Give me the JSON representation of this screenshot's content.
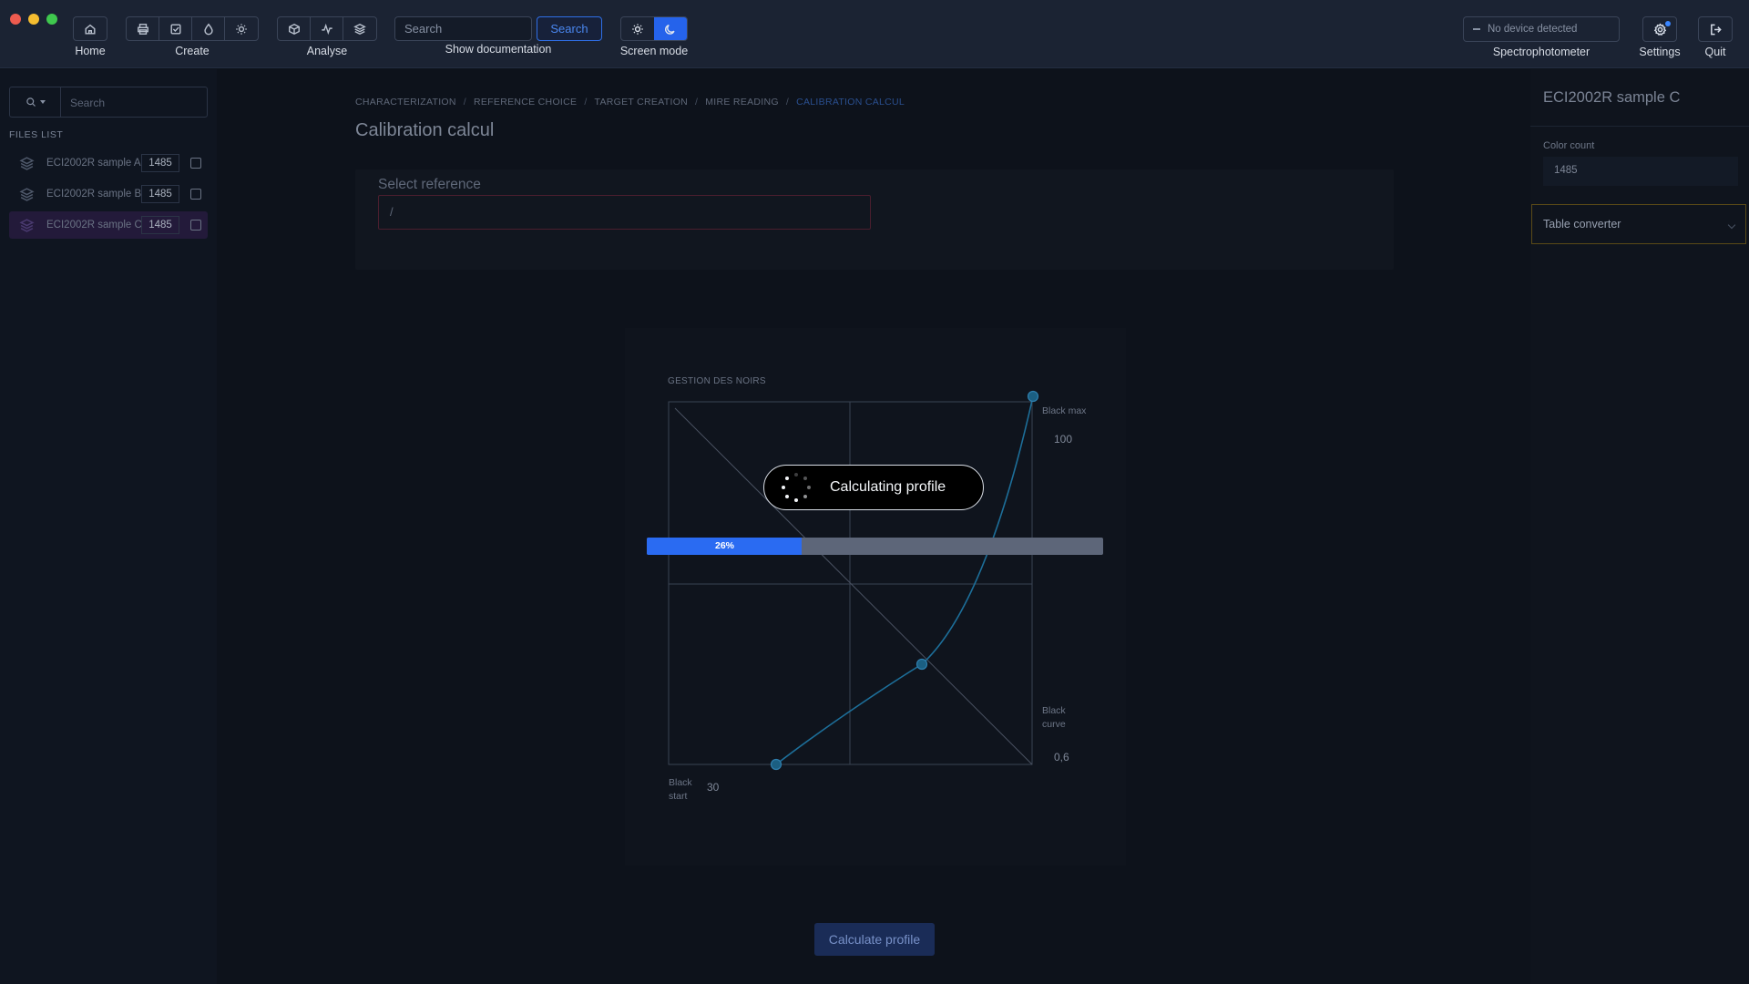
{
  "toolbar": {
    "home_label": "Home",
    "create_label": "Create",
    "analyse_label": "Analyse",
    "search_placeholder": "Search",
    "search_button": "Search",
    "docs_label": "Show documentation",
    "screen_mode_label": "Screen mode",
    "device_status": "No device detected",
    "spectro_label": "Spectrophotometer",
    "settings_label": "Settings",
    "quit_label": "Quit",
    "icons": {
      "home": "home-icon",
      "create": [
        "printer-icon",
        "checkbox-icon",
        "droplet-icon",
        "sun-icon"
      ],
      "analyse": [
        "cube-icon",
        "pulse-icon",
        "layers-icon"
      ],
      "mode": [
        "sun-icon",
        "moon-icon"
      ],
      "settings": "gear-icon",
      "quit": "logout-icon"
    },
    "active_mode": "dark"
  },
  "sidebar": {
    "search_placeholder": "Search",
    "files_label": "FILES LIST",
    "files": [
      {
        "name": "ECI2002R sample A",
        "count": "1485",
        "active": false
      },
      {
        "name": "ECI2002R sample B",
        "count": "1485",
        "active": false
      },
      {
        "name": "ECI2002R sample C",
        "count": "1485",
        "active": true
      }
    ]
  },
  "main": {
    "breadcrumb": [
      "CHARACTERIZATION",
      "REFERENCE CHOICE",
      "TARGET CREATION",
      "MIRE READING",
      "CALIBRATION CALCUL"
    ],
    "title": "Calibration calcul",
    "reference": {
      "title": "Select reference",
      "value": "/"
    },
    "chart": {
      "title": "GESTION DES NOIRS",
      "label_black_max": "Black max",
      "label_black_curve_1": "Black",
      "label_black_curve_2": "curve",
      "label_black_start_1": "Black",
      "label_black_start_2": "start",
      "value_black_max": "100",
      "value_black_curve": "0,6",
      "value_black_start": "30"
    },
    "overlay": {
      "text": "Calculating profile"
    },
    "progress": {
      "percent": 26,
      "label": "26%"
    },
    "calculate_button": "Calculate profile"
  },
  "chart_data": {
    "type": "line",
    "title": "GESTION DES NOIRS",
    "black_start": 30,
    "black_max": 100,
    "black_curve": 0.6
  },
  "right_panel": {
    "title": "ECI2002R sample C",
    "color_count_label": "Color count",
    "color_count_value": "1485",
    "table_converter": "Table converter"
  },
  "colors": {
    "accent": "#2563eb",
    "progress_fill": "#2a6bf2",
    "curve": "#1d6f9a",
    "active_file_bg": "#231a3a"
  }
}
